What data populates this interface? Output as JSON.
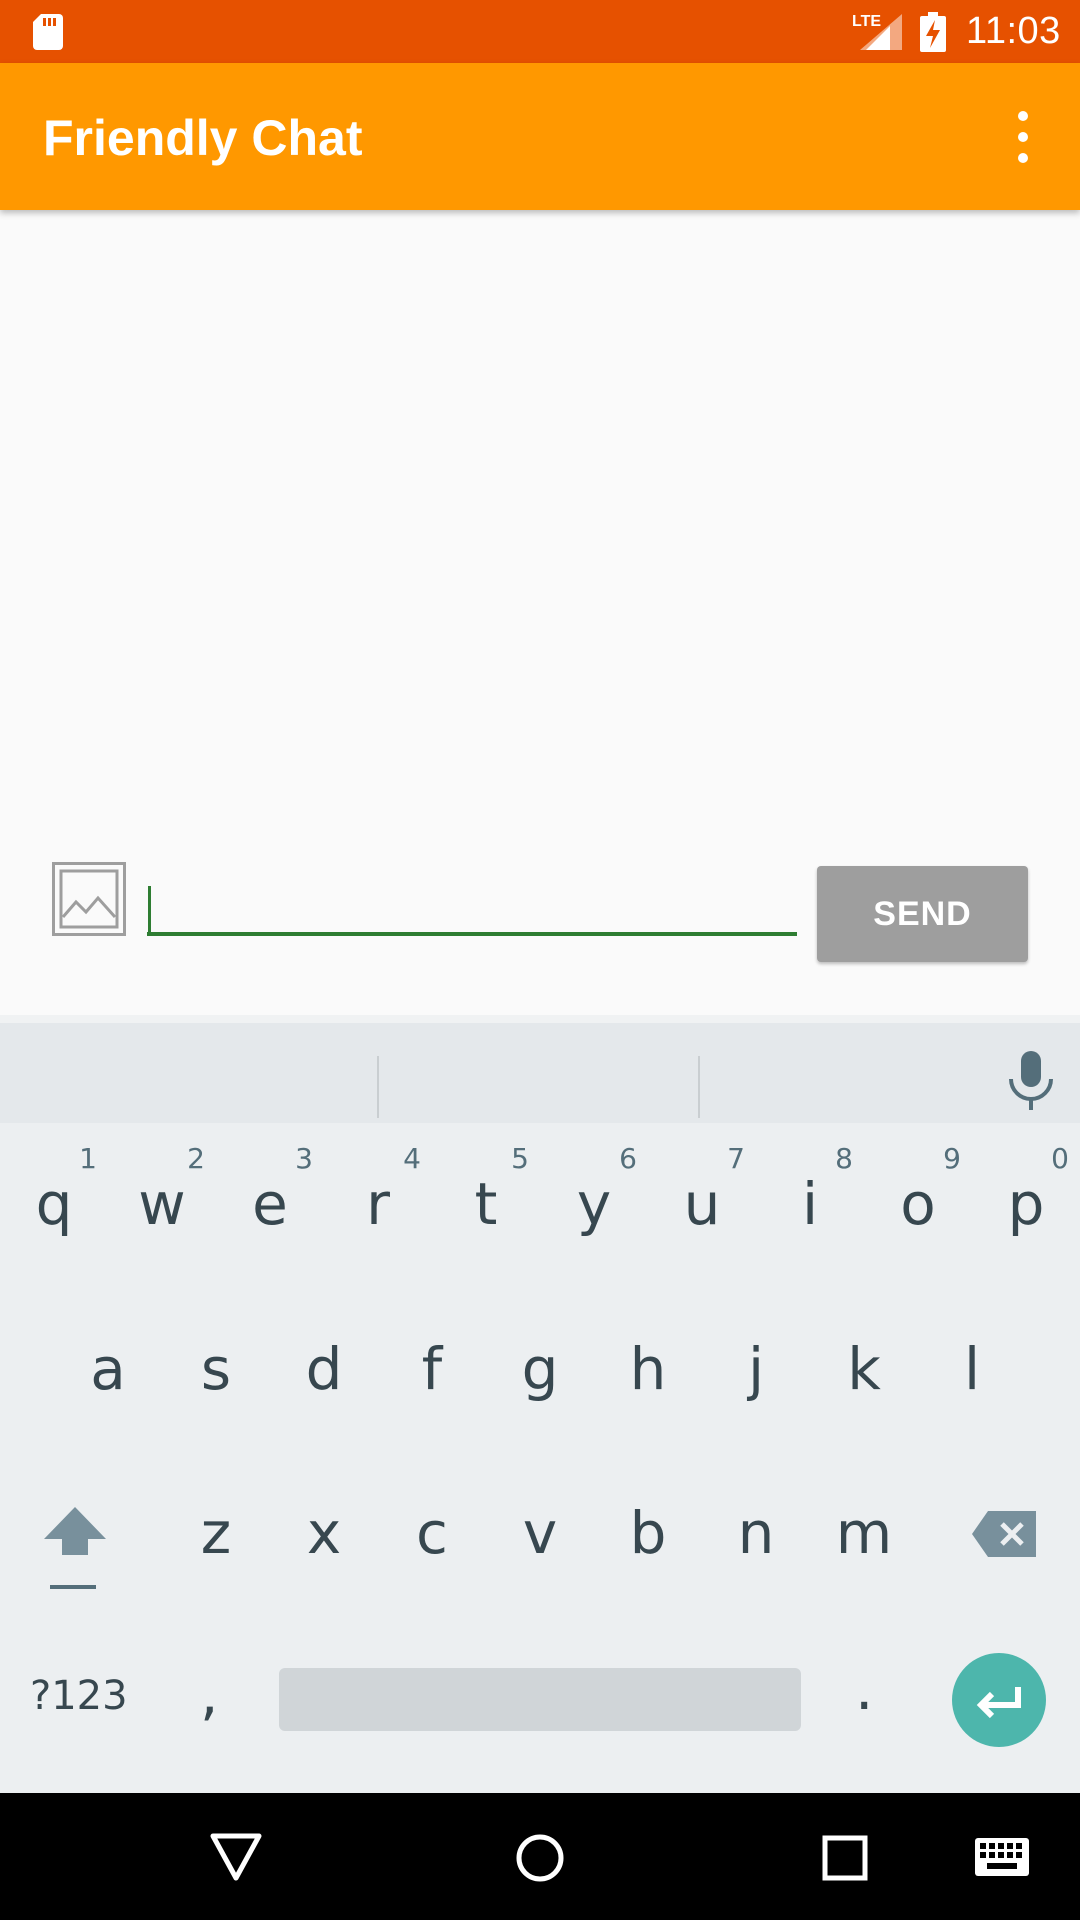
{
  "status_bar": {
    "network_label": "LTE",
    "time": "11:03",
    "icons": [
      "sd-card-icon",
      "signal-icon",
      "battery-charging-icon"
    ]
  },
  "app_bar": {
    "title": "Friendly Chat",
    "menu_icon": "more-vert-icon",
    "color": "#ff9800",
    "status_color": "#e65100"
  },
  "composer": {
    "image_icon": "add-image-icon",
    "input_value": "",
    "send_label": "SEND",
    "accent": "#2e7d32"
  },
  "keyboard": {
    "row1": [
      "q",
      "w",
      "e",
      "r",
      "t",
      "y",
      "u",
      "i",
      "o",
      "p"
    ],
    "row1_hints": [
      "1",
      "2",
      "3",
      "4",
      "5",
      "6",
      "7",
      "8",
      "9",
      "0"
    ],
    "row2": [
      "a",
      "s",
      "d",
      "f",
      "g",
      "h",
      "j",
      "k",
      "l"
    ],
    "row3": [
      "z",
      "x",
      "c",
      "v",
      "b",
      "n",
      "m"
    ],
    "symbols_label": "?123",
    "comma": ",",
    "period": ".",
    "enter_color": "#4db6ac"
  },
  "nav_bar": {
    "icons": [
      "back-icon",
      "home-icon",
      "recents-icon",
      "keyboard-icon"
    ]
  }
}
